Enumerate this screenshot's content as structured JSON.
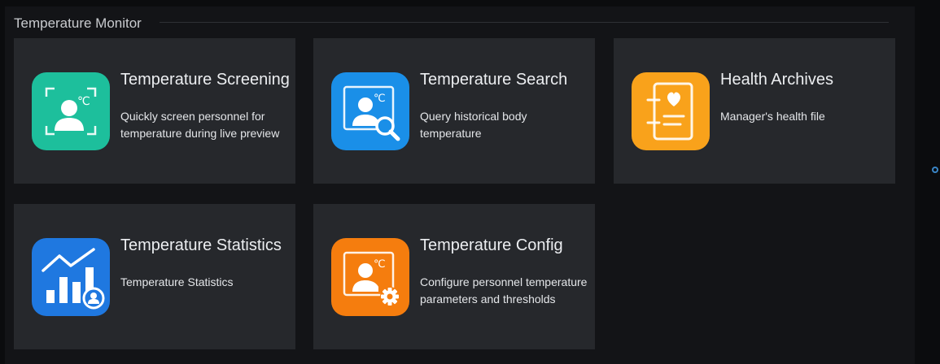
{
  "section": {
    "title": "Temperature Monitor"
  },
  "cards": [
    {
      "title": "Temperature Screening",
      "description": "Quickly screen personnel for temperature during live preview",
      "icon": "face-scan-thermometer-icon",
      "color": "#1dbf9c"
    },
    {
      "title": "Temperature Search",
      "description": "Query historical body temperature",
      "icon": "temperature-search-icon",
      "color": "#1a8fe8"
    },
    {
      "title": "Health Archives",
      "description": "Manager's health file",
      "icon": "health-archive-book-icon",
      "color": "#f9a21b"
    },
    {
      "title": "Temperature Statistics",
      "description": "Temperature Statistics",
      "icon": "statistics-chart-icon",
      "color": "#1f78e0"
    },
    {
      "title": "Temperature Config",
      "description": "Configure personnel temperature parameters and thresholds",
      "icon": "temperature-config-gear-icon",
      "color": "#f57d0e"
    }
  ],
  "colors": {
    "background": "#0b0c0e",
    "panel": "#131417",
    "card": "#26282c",
    "accent": "#3a86c6"
  }
}
